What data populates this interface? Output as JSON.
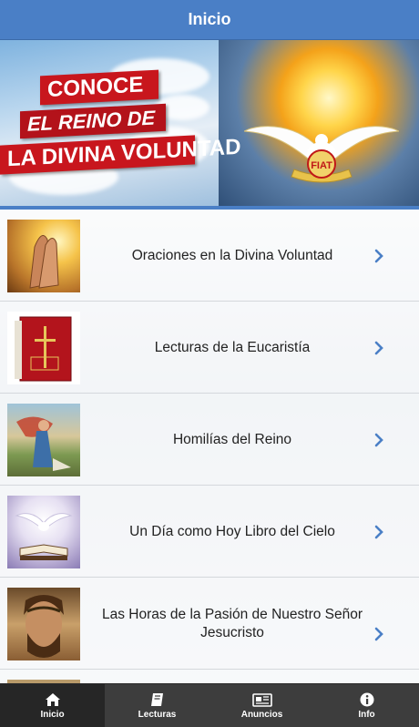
{
  "header": {
    "title": "Inicio"
  },
  "banner": {
    "line1": "CONOCE",
    "line2": "EL REINO DE",
    "line3": "LA DIVINA VOLUNTAD",
    "seal": "FIAT"
  },
  "list": [
    {
      "label": "Oraciones en la Divina Voluntad",
      "icon": "praying-hands-image"
    },
    {
      "label": "Lecturas de la Eucaristía",
      "icon": "red-bible-image"
    },
    {
      "label": "Homilías del Reino",
      "icon": "painting-image"
    },
    {
      "label": "Un Día como Hoy Libro del Cielo",
      "icon": "dove-book-image"
    },
    {
      "label": "Las Horas de la Pasión de Nuestro Señor Jesucristo",
      "icon": "jesus-image"
    }
  ],
  "tabs": [
    {
      "label": "Inicio",
      "icon": "home-icon",
      "active": true
    },
    {
      "label": "Lecturas",
      "icon": "book-icon",
      "active": false
    },
    {
      "label": "Anuncios",
      "icon": "newspaper-icon",
      "active": false
    },
    {
      "label": "Info",
      "icon": "info-icon",
      "active": false
    }
  ],
  "colors": {
    "header": "#4a7fc6",
    "tabbar": "#3d3d3d",
    "chevron": "#4a7fc6",
    "banner_red": "#c8161d"
  }
}
